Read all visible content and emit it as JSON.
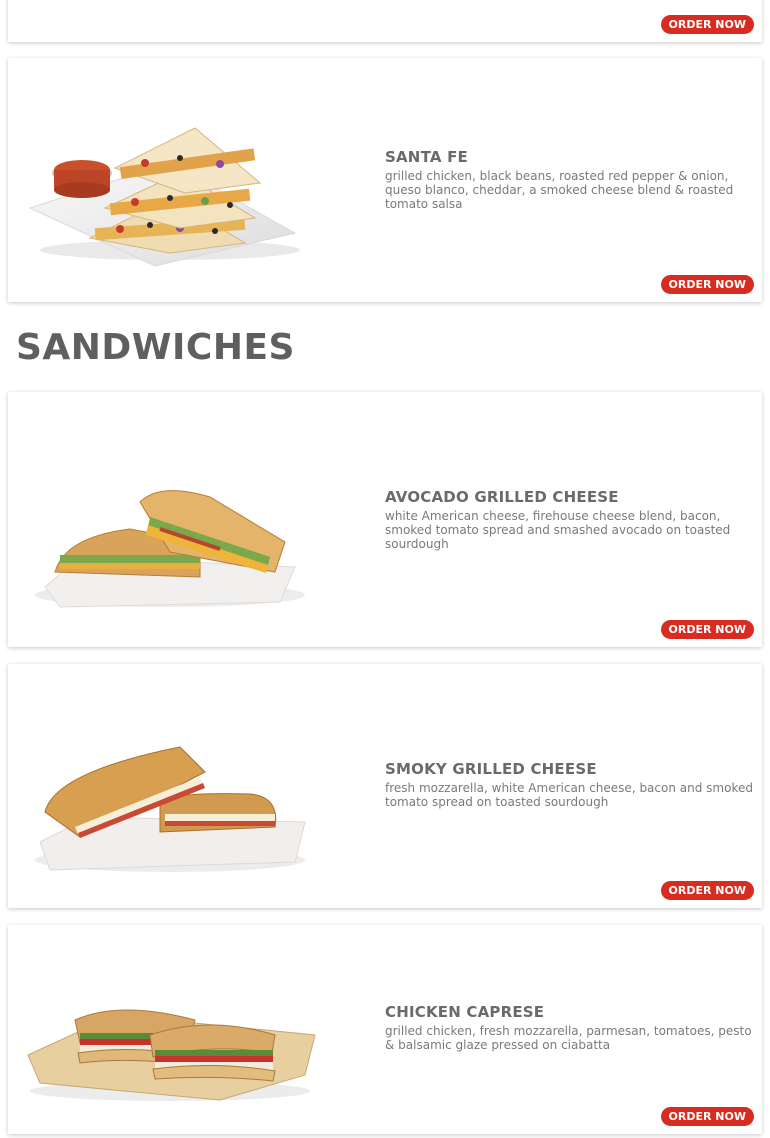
{
  "order_label": "ORDER NOW",
  "section": {
    "title": "SANDWICHES"
  },
  "items": [
    {
      "name": "SANTA FE",
      "desc": "grilled chicken, black beans, roasted red pepper & onion, queso blanco, cheddar, a smoked cheese blend & roasted tomato salsa"
    },
    {
      "name": "AVOCADO GRILLED CHEESE",
      "desc": "white American cheese, firehouse cheese blend, bacon, smoked tomato spread and smashed avocado on toasted sourdough"
    },
    {
      "name": "SMOKY GRILLED CHEESE",
      "desc": "fresh mozzarella, white American cheese, bacon and smoked tomato spread on toasted sourdough"
    },
    {
      "name": "CHICKEN CAPRESE",
      "desc": "grilled chicken, fresh mozzarella, parmesan, tomatoes, pesto & balsamic glaze pressed on ciabatta"
    }
  ],
  "colors": {
    "accent": "#d92c21",
    "heading": "#5f5f5f",
    "text": "#7a7a7a"
  }
}
